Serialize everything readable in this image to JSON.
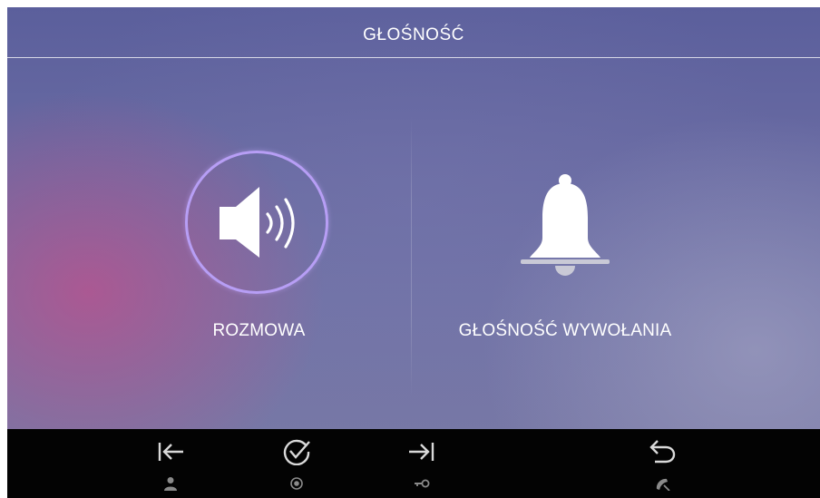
{
  "header": {
    "title": "GŁOŚNOŚĆ"
  },
  "options": [
    {
      "label": "ROZMOWA",
      "icon": "speaker-icon",
      "selected": true
    },
    {
      "label": "GŁOŚNOŚĆ WYWOŁANIA",
      "icon": "bell-icon",
      "selected": false
    }
  ],
  "bottom_bar": {
    "buttons": [
      {
        "icon": "arrow-left-to-bar-icon",
        "sub_icon": "person-icon"
      },
      {
        "icon": "check-circle-icon",
        "sub_icon": "record-dot-icon"
      },
      {
        "icon": "arrow-right-to-bar-icon",
        "sub_icon": "key-icon"
      },
      {
        "icon": "return-arrow-icon",
        "sub_icon": "phone-hangup-icon"
      }
    ]
  },
  "colors": {
    "selection_ring": "#b79ef5",
    "bottom_bar": "#030303",
    "text": "#ffffff",
    "icon_gray": "#8a8a8a"
  }
}
